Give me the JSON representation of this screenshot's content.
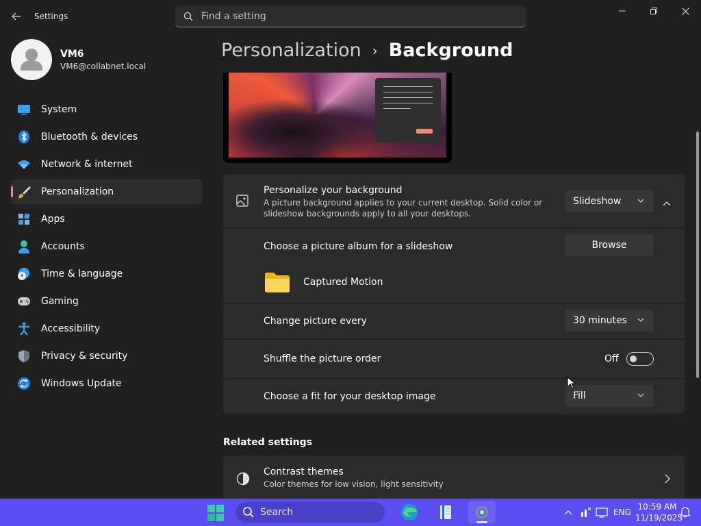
{
  "app": {
    "title": "Settings"
  },
  "search": {
    "placeholder": "Find a setting"
  },
  "profile": {
    "name": "VM6",
    "email": "VM6@collabnet.local"
  },
  "sidebar": {
    "items": [
      {
        "label": "System",
        "icon": "monitor-icon"
      },
      {
        "label": "Bluetooth & devices",
        "icon": "bluetooth-icon"
      },
      {
        "label": "Network & internet",
        "icon": "wifi-icon"
      },
      {
        "label": "Personalization",
        "icon": "brush-icon",
        "active": true
      },
      {
        "label": "Apps",
        "icon": "apps-icon"
      },
      {
        "label": "Accounts",
        "icon": "person-icon"
      },
      {
        "label": "Time & language",
        "icon": "globe-clock-icon"
      },
      {
        "label": "Gaming",
        "icon": "gamepad-icon"
      },
      {
        "label": "Accessibility",
        "icon": "accessibility-icon"
      },
      {
        "label": "Privacy & security",
        "icon": "shield-icon"
      },
      {
        "label": "Windows Update",
        "icon": "update-icon"
      }
    ]
  },
  "breadcrumb": {
    "parent": "Personalization",
    "separator": "›",
    "current": "Background"
  },
  "background": {
    "title": "Personalize your background",
    "desc_line1": "A picture background applies to your current desktop. Solid color or",
    "desc_line2": "slideshow backgrounds apply to all your desktops.",
    "mode": "Slideshow",
    "album_label": "Choose a picture album for a slideshow",
    "browse_label": "Browse",
    "album_name": "Captured Motion",
    "interval_label": "Change picture every",
    "interval_value": "30 minutes",
    "shuffle_label": "Shuffle the picture order",
    "shuffle_state": "Off",
    "shuffle_on": false,
    "fit_label": "Choose a fit for your desktop image",
    "fit_value": "Fill"
  },
  "related": {
    "title": "Related settings",
    "contrast_title": "Contrast themes",
    "contrast_desc": "Color themes for low vision, light sensitivity"
  },
  "taskbar": {
    "search_label": "Search",
    "language": "ENG",
    "time": "10:59 AM",
    "date": "11/19/2025"
  },
  "colors": {
    "accent": "#f08a7a",
    "taskbar": "#5a4ef0",
    "background": "#202020",
    "card": "#2b2b2b"
  }
}
